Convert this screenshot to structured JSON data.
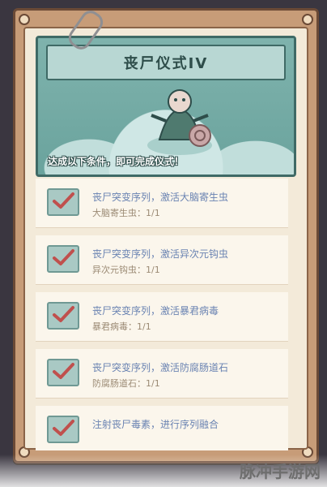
{
  "banner": {
    "title": "丧尸仪式IV",
    "subtitle": "达成以下条件，即可完成仪式！"
  },
  "tasks": [
    {
      "title": "丧尸突变序列，激活大脑寄生虫",
      "progress": "大脑寄生虫：1/1",
      "completed": true
    },
    {
      "title": "丧尸突变序列，激活异次元钩虫",
      "progress": "异次元钩虫：1/1",
      "completed": true
    },
    {
      "title": "丧尸突变序列，激活暴君病毒",
      "progress": "暴君病毒：1/1",
      "completed": true
    },
    {
      "title": "丧尸突变序列，激活防腐肠道石",
      "progress": "防腐肠道石：1/1",
      "completed": true
    },
    {
      "title": "注射丧尸毒素，进行序列融合",
      "progress": "",
      "completed": true
    }
  ],
  "watermark": "脉冲手游网",
  "colors": {
    "accent": "#6a83b2",
    "banner": "#5f9892",
    "check": "#c0504d"
  }
}
